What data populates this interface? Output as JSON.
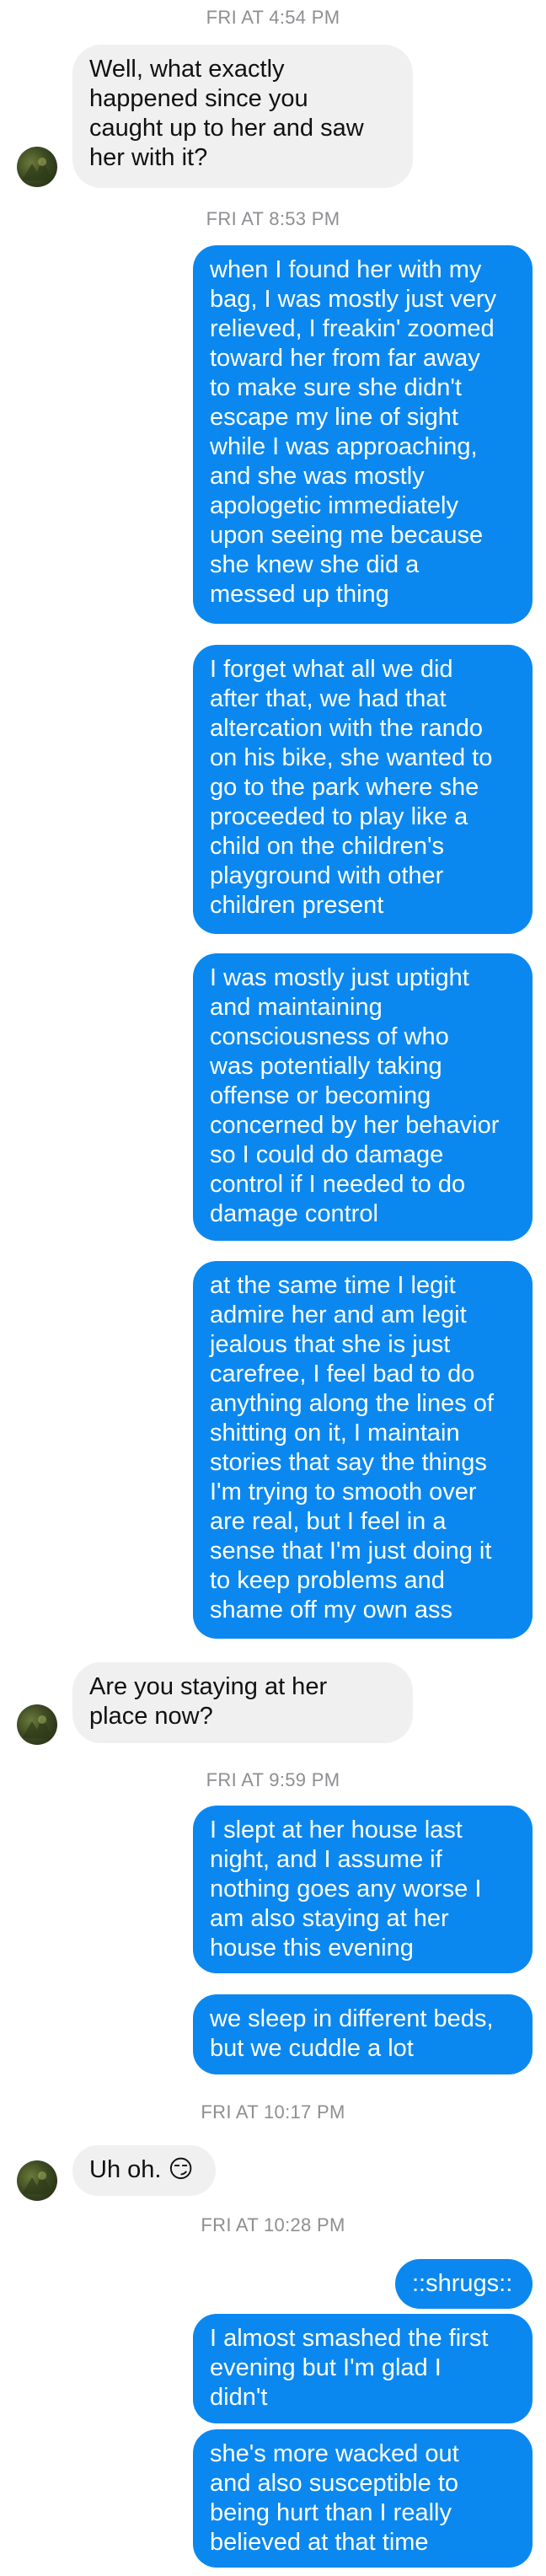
{
  "colors": {
    "incoming_bg": "#f0f0f0",
    "outgoing_bg": "#0a88f0",
    "timestamp": "#8e8e93"
  },
  "contact": {
    "avatar_icon": "contact-avatar-icon"
  },
  "timestamps": [
    "FRI AT 4:54 PM",
    "FRI AT 8:53 PM",
    "FRI AT 9:59 PM",
    "FRI AT 10:17 PM",
    "FRI AT 10:28 PM"
  ],
  "messages": [
    {
      "from": "them",
      "text": "Well, what exactly\nhappened since you\ncaught up to her and saw\nher with it?"
    },
    {
      "from": "me",
      "text": "when I found her with my\nbag, I was mostly just very\nrelieved, I freakin' zoomed\ntoward her from far away\nto make sure she didn't\nescape my line of sight\nwhile I was approaching,\nand she was mostly\napologetic immediately\nupon seeing me because\nshe knew she did a\nmessed up thing"
    },
    {
      "from": "me",
      "text": "I forget what all we did\nafter that, we had that\naltercation with the rando\non his bike, she wanted to\ngo to the park where she\nproceeded to play like a\nchild on the children's\nplayground with other\nchildren present"
    },
    {
      "from": "me",
      "text": "I was mostly just uptight\nand maintaining\nconsciousness of who\nwas potentially taking\noffense or becoming\nconcerned by her behavior\nso I could do damage\ncontrol if I needed to do\ndamage control"
    },
    {
      "from": "me",
      "text": "at the same time I legit\nadmire her and am legit\njealous that she is just\ncarefree, I feel bad to do\nanything along the lines of\nshitting on it, I maintain\nstories that say the things\nI'm trying to smooth over\nare real, but I feel in a\nsense that I'm just doing it\nto keep problems and\nshame off my own ass"
    },
    {
      "from": "them",
      "text": "Are you staying at her\nplace now?"
    },
    {
      "from": "me",
      "text": "I slept at her house last\nnight, and I assume if\nnothing goes any worse I\nam also staying at her\nhouse this evening"
    },
    {
      "from": "me",
      "text": "we sleep in different beds,\nbut we cuddle a lot"
    },
    {
      "from": "them",
      "text": "Uh oh. 😏"
    },
    {
      "from": "me",
      "text": "::shrugs::"
    },
    {
      "from": "me",
      "text": "I almost smashed the first\nevening but I'm glad I\ndidn't"
    },
    {
      "from": "me",
      "text": "she's more wacked out\nand also susceptible to\nbeing hurt than I really\nbelieved at that time"
    }
  ]
}
